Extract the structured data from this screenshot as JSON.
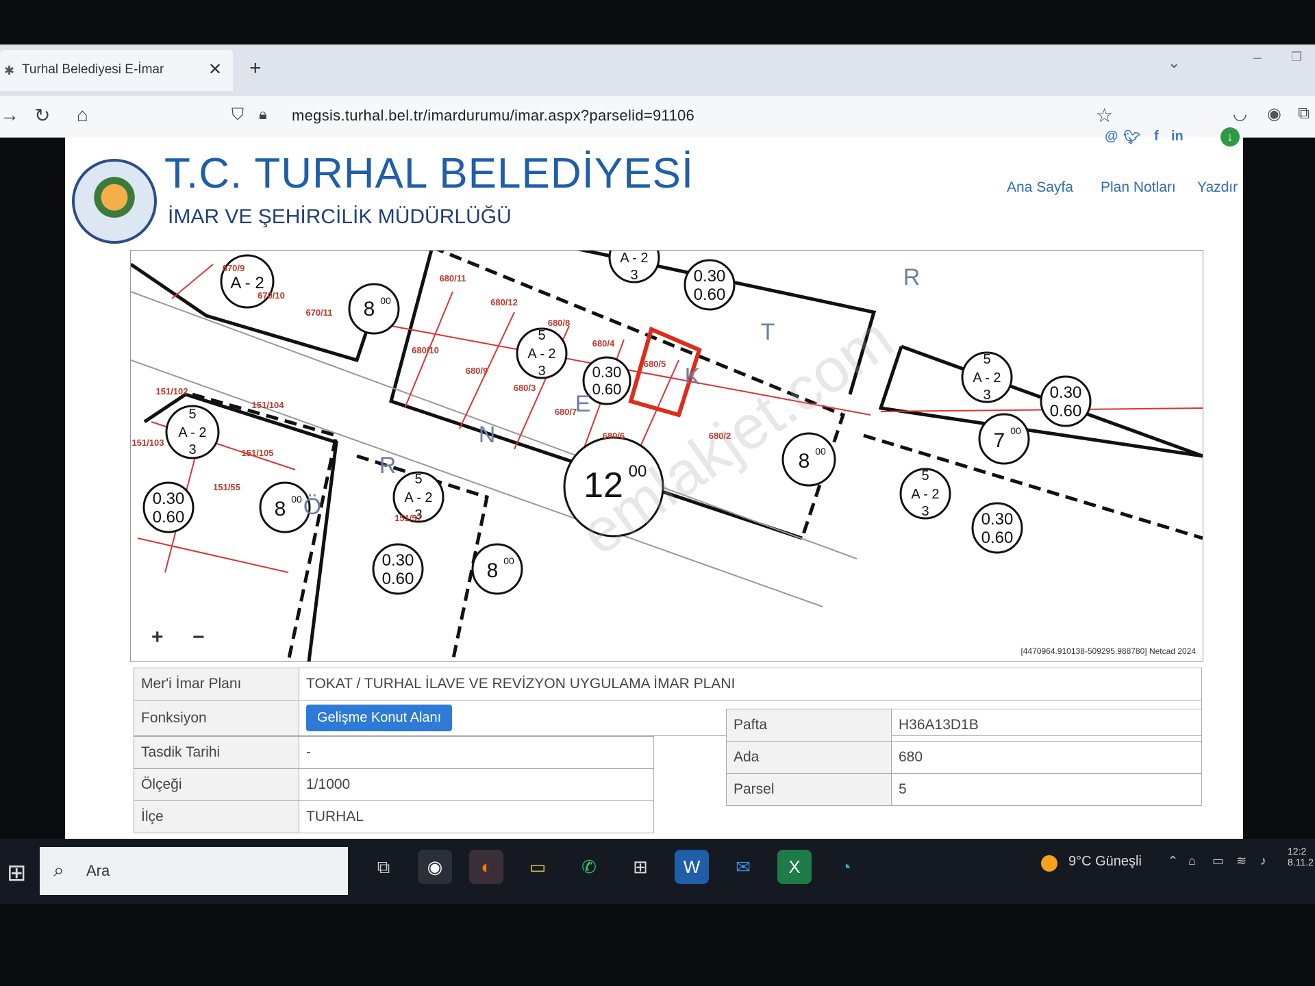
{
  "browser": {
    "tab_title": "Turhal Belediyesi E-İmar",
    "url": "megsis.turhal.bel.tr/imardurumu/imar.aspx?parselid=91106"
  },
  "site": {
    "title": "T.C. TURHAL BELEDİYESİ",
    "subtitle": "İMAR VE ŞEHİRCİLİK MÜDÜRLÜĞÜ",
    "nav": [
      "Ana Sayfa",
      "Plan Notları",
      "Yazdır"
    ]
  },
  "map": {
    "parcel_labels": [
      "670/9",
      "670/10",
      "670/11",
      "680/11",
      "680/12",
      "680/10",
      "680/8",
      "680/9",
      "680/4",
      "680/3",
      "680/5",
      "680/7",
      "680/6",
      "680/2",
      "151/102",
      "151/104",
      "151/103",
      "151/105",
      "151/55",
      "151/57"
    ],
    "zone_labels": [
      {
        "top": "5",
        "mid": "A - 2",
        "bot": "3"
      }
    ],
    "ratio_labels": [
      {
        "top": "0.30",
        "bot": "0.60"
      }
    ],
    "road_widths": [
      "8",
      "12",
      "7"
    ],
    "road_decimals": "00",
    "street_letters": [
      "R",
      "T",
      "K",
      "E",
      "N",
      "Ö",
      "R"
    ],
    "zoom_in": "+",
    "zoom_out": "−",
    "coords": "[4470964.910138-509295.988780] Netcad 2024",
    "watermark": "emlakjet.com"
  },
  "info": {
    "plan_label": "Mer'i İmar Planı",
    "plan_value": "TOKAT / TURHAL İLAVE VE REVİZYON UYGULAMA İMAR PLANI",
    "function_label": "Fonksiyon",
    "function_value": "Gelişme Konut Alanı",
    "approval_label": "Tasdik Tarihi",
    "approval_value": "-",
    "scale_label": "Ölçeği",
    "scale_value": "1/1000",
    "district_label": "İlçe",
    "district_value": "TURHAL",
    "pafta_label": "Pafta",
    "pafta_value": "H36A13D1B",
    "ada_label": "Ada",
    "ada_value": "680",
    "parsel_label": "Parsel",
    "parsel_value": "5"
  },
  "taskbar": {
    "search_text": "Ara",
    "weather": "9°C  Güneşli",
    "clock_time": "12:2",
    "clock_date": "8.11.2"
  }
}
